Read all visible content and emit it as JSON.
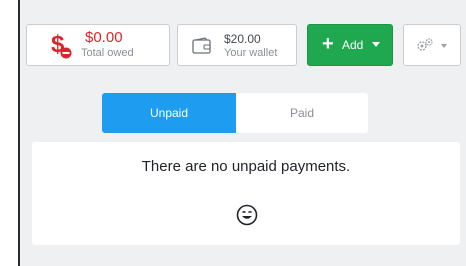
{
  "toolbar": {
    "owed": {
      "amount": "$0.00",
      "label": "Total owed"
    },
    "wallet": {
      "amount": "$20.00",
      "label": "Your wallet"
    },
    "add": {
      "label": "Add"
    }
  },
  "tabs": [
    {
      "label": "Unpaid",
      "active": true
    },
    {
      "label": "Paid",
      "active": false
    }
  ],
  "panel": {
    "message": "There are no unpaid payments."
  },
  "icons": {
    "owed": "dollar-minus-icon",
    "wallet": "wallet-icon",
    "add": "plus-icon",
    "settings": "gears-icon",
    "empty": "smile-icon"
  },
  "colors": {
    "danger": "#d9262c",
    "success": "#1fa84f",
    "accent": "#1e9df0"
  }
}
